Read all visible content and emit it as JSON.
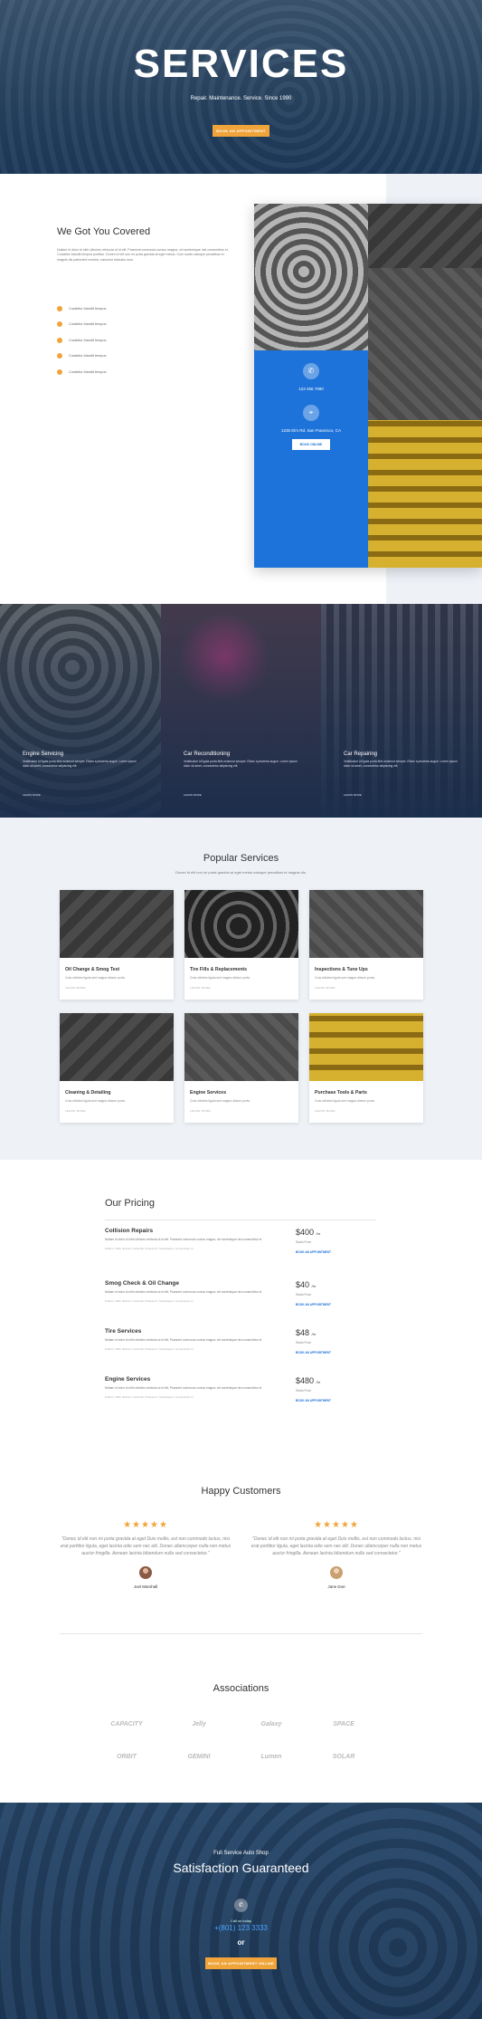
{
  "hero": {
    "title": "SERVICES",
    "subtitle": "Repair. Maintenance. Service. Since 1990",
    "button": "BOOK AN APPOINTMENT"
  },
  "covered": {
    "title": "We Got You Covered",
    "body": "Nullam id dolor id nibh ultricies vehicula ut id elit. Praesent commodo cursus magna, vel scelerisque nisl consectetur et. Curabitur blandit tempus porttitor. Donec id elit non mi porta gravida at eget metus. Cum sociis natoque penatibus et magnis dis parturient montes, nascetur ridiculus mus.",
    "checklist": [
      "Curabitur blandit tempus",
      "Curabitur blandit tempus",
      "Curabitur blandit tempus",
      "Curabitur blandit tempus",
      "Curabitur blandit tempus"
    ],
    "phone": "123 456 7890",
    "address": "1235 Elm Rd. San Francisco, CA",
    "contact_button": "BOOK ONLINE"
  },
  "features": [
    {
      "title": "Engine Servicing",
      "text": "Vestibulum id ligula porta felis euismod semper. Etiam a pharetra augue. Lorem ipsum dolor sit amet, consectetur adipiscing elit.",
      "link": "LEARN MORE"
    },
    {
      "title": "Car Reconditioning",
      "text": "Vestibulum id ligula porta felis euismod semper. Etiam a pharetra augue. Lorem ipsum dolor sit amet, consectetur adipiscing elit.",
      "link": "LEARN MORE"
    },
    {
      "title": "Car Repairing",
      "text": "Vestibulum id ligula porta felis euismod semper. Etiam a pharetra augue. Lorem ipsum dolor sit amet, consectetur adipiscing elit.",
      "link": "LEARN MORE"
    }
  ],
  "popular": {
    "title": "Popular Services",
    "subtitle": "Donec id elit non mi porta gravida at eget metus natoque penatibus et magnis dis.",
    "cards": [
      {
        "title": "Oil Change & Smog Test",
        "text": "Cras ultricies ligula sed magna dictum porta.",
        "link": "LEARN MORE"
      },
      {
        "title": "Tire Fills & Replacements",
        "text": "Cras ultricies ligula sed magna dictum porta.",
        "link": "LEARN MORE"
      },
      {
        "title": "Inspections & Tune Ups",
        "text": "Cras ultricies ligula sed magna dictum porta.",
        "link": "LEARN MORE"
      },
      {
        "title": "Cleaning & Detailing",
        "text": "Cras ultricies ligula sed magna dictum porta.",
        "link": "LEARN MORE"
      },
      {
        "title": "Engine Services",
        "text": "Cras ultricies ligula sed magna dictum porta.",
        "link": "LEARN MORE"
      },
      {
        "title": "Purchase Tools & Parts",
        "text": "Cras ultricies ligula sed magna dictum porta.",
        "link": "LEARN MORE"
      }
    ]
  },
  "pricing": {
    "title": "Our Pricing",
    "items": [
      {
        "name": "Collision Repairs",
        "desc": "Nullam id dolor id nibh ultricies vehicula ut id elit. Praesent commodo cursus magna, vel scelerisque nisl consectetur et.",
        "tags": "Nullam / Nibh ultricies / Vehicula / Praesent / Scelerisque / Consectetur et",
        "price": "$400",
        "unit": "/hr",
        "sub": "Starts From",
        "book": "BOOK AN APPOINTMENT"
      },
      {
        "name": "Smog Check & Oil Change",
        "desc": "Nullam id dolor id nibh ultricies vehicula ut id elit. Praesent commodo cursus magna, vel scelerisque nisl consectetur et.",
        "tags": "Nullam / Nibh ultricies / Vehicula / Praesent / Scelerisque / Consectetur et",
        "price": "$40",
        "unit": "/hr",
        "sub": "Starts From",
        "book": "BOOK AN APPOINTMENT"
      },
      {
        "name": "Tire Services",
        "desc": "Nullam id dolor id nibh ultricies vehicula ut id elit. Praesent commodo cursus magna, vel scelerisque nisl consectetur et.",
        "tags": "Nullam / Nibh ultricies / Vehicula / Praesent / Scelerisque / Consectetur et",
        "price": "$48",
        "unit": "/hr",
        "sub": "Starts From",
        "book": "BOOK AN APPOINTMENT"
      },
      {
        "name": "Engine Services",
        "desc": "Nullam id dolor id nibh ultricies vehicula ut id elit. Praesent commodo cursus magna, vel scelerisque nisl consectetur et.",
        "tags": "Nullam / Nibh ultricies / Vehicula / Praesent / Scelerisque / Consectetur et",
        "price": "$480",
        "unit": "/hr",
        "sub": "Starts From",
        "book": "BOOK AN APPOINTMENT"
      }
    ]
  },
  "testimonials": {
    "title": "Happy Customers",
    "items": [
      {
        "quote": "\"Donec id elit non mi porta gravida at eget Duis mollis, est non commodo luctus, nisi erat porttitor ligula, eget lacinia odio sem nec elit. Donec ullamcorper nulla non metus auctor fringilla. Aenean lacinia bibendum nulla sed consectetur.\"",
        "name": "Joel Marshall"
      },
      {
        "quote": "\"Donec id elit non mi porta gravida at eget Duis mollis, est non commodo luctus, nisi erat porttitor ligula, eget lacinia odio sem nec elit. Donec ullamcorper nulla non metus auctor fringilla. Aenean lacinia bibendum nulla sed consectetur.\"",
        "name": "Jane Doe"
      }
    ]
  },
  "associations": {
    "title": "Associations",
    "logos": [
      "CAPACITY",
      "Jelly",
      "Galaxy",
      "SPACE",
      "ORBIT",
      "GEMINI",
      "Lumen",
      "SOLAR"
    ]
  },
  "cta": {
    "kicker": "Full Service Auto Shop",
    "title": "Satisfaction Guaranteed",
    "call_label": "Call us today",
    "phone": "+(801) 123 3333",
    "or": "or",
    "button": "BOOK AN APPOINTMENT ONLINE"
  },
  "colors": {
    "accent": "#f0a43a",
    "blue": "#1d73d9",
    "navy": "#1f3b5c"
  }
}
